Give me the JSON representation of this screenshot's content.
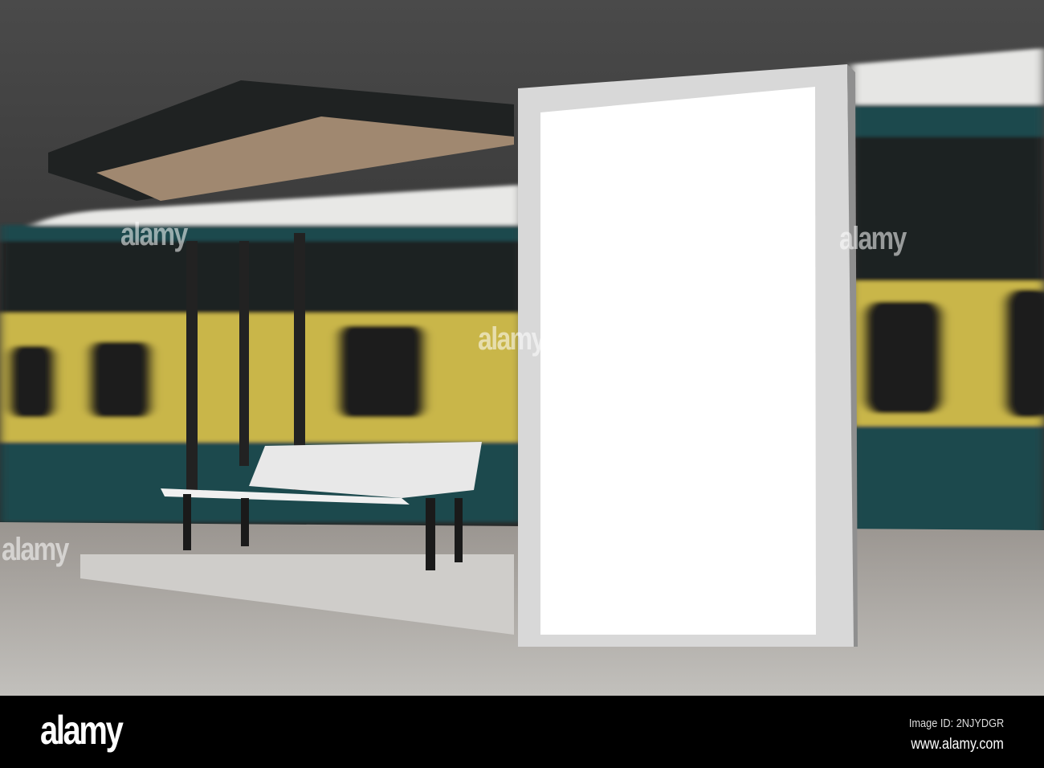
{
  "photo": {
    "subject": "blank vertical billboard at tram stop",
    "watermark_text": "alamy",
    "colors": {
      "train_yellow": "#c9b64a",
      "train_teal": "#1c4a4d",
      "ceiling": "#2e2e2e",
      "billboard_frame": "#d8d8d8"
    }
  },
  "footer": {
    "logo": "alamy",
    "image_id": "Image ID: 2NJYDGR",
    "url": "www.alamy.com"
  }
}
